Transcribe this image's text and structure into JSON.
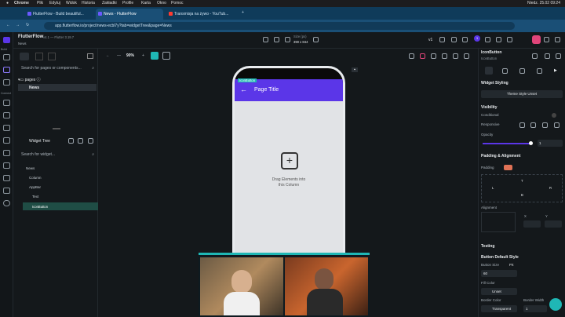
{
  "mac_bar": {
    "app": "Chrome",
    "menus": [
      "Plik",
      "Edytuj",
      "Widok",
      "Historia",
      "Zakładki",
      "Profile",
      "Karta",
      "Okno",
      "Pomoc"
    ],
    "clock": "Niedz. 25.02 09:24"
  },
  "browser": {
    "tabs": [
      "FlutterFlow - Build beautiful...",
      "News - FlutterFlow",
      "Transmisja na żywo - YouTub..."
    ],
    "url": "app.flutterflow.io/project/news-ecbl7y?tab=widgetTree&page=News"
  },
  "rail": {
    "labels": [
      "Build",
      "Connect"
    ]
  },
  "topbar": {
    "app_name": "FlutterFlow",
    "version": "v4.1 — Flutter 3.19.7",
    "page": "News",
    "zoom": "90%",
    "size_label": "Size (px)",
    "size_value": "390 x 844",
    "version_pill": "v1",
    "update_count": "1"
  },
  "pages_panel": {
    "search": "Search for pages or components...",
    "header": "pages",
    "items": [
      "News"
    ]
  },
  "widget_tree": {
    "title": "Widget Tree",
    "search": "Search for widget...",
    "items": [
      "News",
      "Column",
      "AppBar",
      "Text",
      "IconButton"
    ]
  },
  "phone": {
    "tag": "IconButton",
    "back": "←",
    "title": "Page Title",
    "plus": "+",
    "drop_line1": "Drag Elements into",
    "drop_line2": "this Column",
    "chat_icon": "▪"
  },
  "props": {
    "title": "IconButton",
    "subtitle": "IconButton",
    "widget_styling": "Widget Styling",
    "theme_style": "Theme Style Unset",
    "visibility": "Visibility",
    "conditional": "Conditional",
    "responsive": "Responsive",
    "opacity": "Opacity",
    "opacity_value": "1",
    "opacity_level": 1.0,
    "padding_alignment": "Padding & Alignment",
    "padding": "Padding",
    "pad_t": "T",
    "pad_l": "L",
    "pad_r": "R",
    "pad_b": "B",
    "alignment": "Alignment",
    "align_x": "X",
    "align_y": "Y",
    "testing": "Testing",
    "button_default": "Button Default Style",
    "button_size": "Button Size",
    "px": "PX",
    "size_value": "60",
    "fill_color": "Fill Color",
    "fill_value": "Unset",
    "border_color": "Border Color",
    "border_value": "Transparent",
    "border_width": "Border Width",
    "border_width_value": "1"
  },
  "colors": {
    "accent": "#5b36e8",
    "tab_bar": "#0f3b5a",
    "active_tab": "#1a4f76",
    "video_border": "#1fb7b5"
  },
  "icons": [
    "search-icon",
    "grid-icon",
    "gear-icon",
    "plus-icon",
    "back-arrow-icon",
    "more-icon",
    "help-icon"
  ]
}
